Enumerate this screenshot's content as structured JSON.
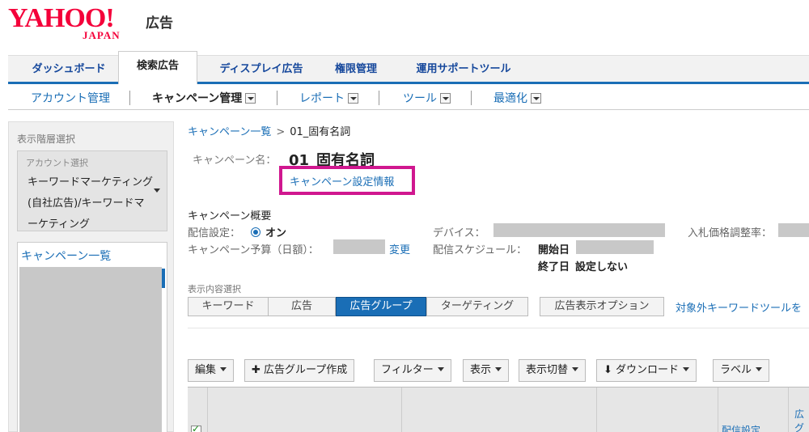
{
  "logo": {
    "brand": "YAHOO!",
    "sub": "JAPAN",
    "suffix": "広告"
  },
  "tabs": [
    {
      "label": "ダッシュボード"
    },
    {
      "label": "検索広告"
    },
    {
      "label": "ディスプレイ広告"
    },
    {
      "label": "権限管理"
    },
    {
      "label": "運用サポートツール"
    }
  ],
  "subnav": [
    {
      "label": "アカウント管理"
    },
    {
      "label": "キャンペーン管理"
    },
    {
      "label": "レポート"
    },
    {
      "label": "ツール"
    },
    {
      "label": "最適化"
    }
  ],
  "sidebar": {
    "title": "表示階層選択",
    "account_label": "アカウント選択",
    "account_name": "キーワードマーケティング(自社広告)/キーワードマーケティング",
    "campaign_list_title": "キャンペーン一覧"
  },
  "breadcrumb": {
    "link": "キャンペーン一覧",
    "sep": ">",
    "current": "01_固有名詞"
  },
  "campaign": {
    "name_label": "キャンペーン名：",
    "name": "01_固有名詞",
    "settings_link": "キャンペーン設定情報"
  },
  "summary": {
    "title": "キャンペーン概要",
    "delivery_label": "配信設定：",
    "delivery_value": "オン",
    "budget_label": "キャンペーン予算（日額）：",
    "budget_change": "変更",
    "device_label": "デバイス：",
    "schedule_label": "配信スケジュール：",
    "start_label": "開始日",
    "end_label": "終了日",
    "end_value": "設定しない",
    "bid_label": "入札価格調整率："
  },
  "display": {
    "label": "表示内容選択",
    "tabs": [
      "キーワード",
      "広告",
      "広告グループ",
      "ターゲティング",
      "広告表示オプション"
    ],
    "external_link": "対象外キーワードツールを"
  },
  "toolbar": {
    "edit": "編集",
    "create": "✚ 広告グループ作成",
    "filter": "フィルター",
    "view": "表示",
    "switch": "表示切替",
    "download": "ダウンロード",
    "label": "ラベル"
  },
  "table": {
    "col_delivery": "配信設定",
    "col_partial": "広 グル"
  }
}
